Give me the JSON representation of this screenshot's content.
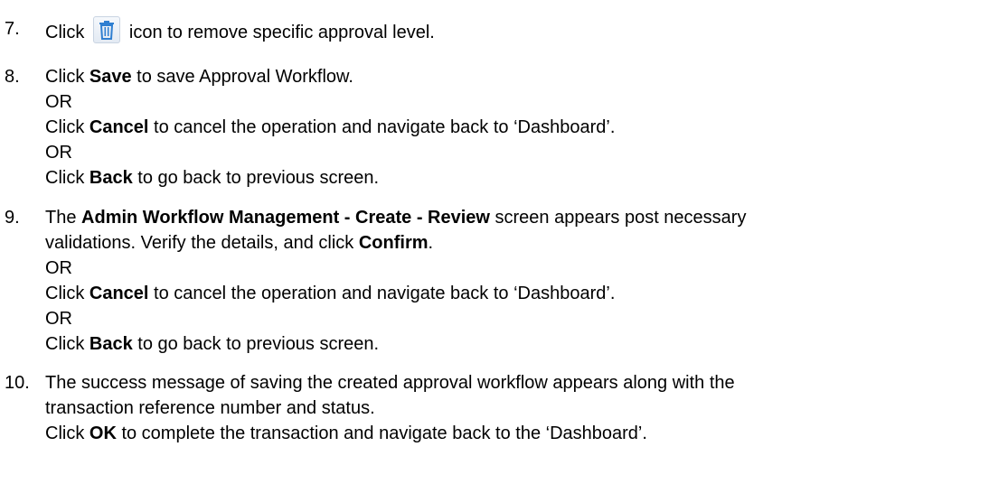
{
  "steps": [
    {
      "number": "7.",
      "parts": [
        "Click",
        "icon to remove specific approval level."
      ],
      "icon": "trash-icon"
    },
    {
      "number": "8.",
      "line1": [
        "Click ",
        "Save",
        " to save Approval Workflow."
      ],
      "or1": "OR",
      "line2": [
        "Click ",
        "Cancel",
        " to cancel the operation and navigate back to ‘Dashboard’."
      ],
      "or2": "OR",
      "line3": [
        "Click ",
        "Back",
        " to go back to previous screen."
      ]
    },
    {
      "number": "9.",
      "line1": [
        "The ",
        "Admin Workflow Management - Create - Review",
        " screen appears post necessary"
      ],
      "line1b": [
        "validations. Verify the details, and click ",
        "Confirm",
        "."
      ],
      "or1": "OR",
      "line2": [
        "Click ",
        "Cancel",
        " to cancel the operation and navigate back to ‘Dashboard’."
      ],
      "or2": "OR",
      "line3": [
        "Click ",
        "Back",
        " to go back to previous screen."
      ]
    },
    {
      "number": "10.",
      "line1": "The success message of saving the created approval workflow appears along with the",
      "line1b": "transaction reference number and status.",
      "line2": [
        "Click ",
        "OK",
        " to complete the transaction and navigate back to the ‘Dashboard’."
      ]
    }
  ],
  "colors": {
    "icon_blue": "#2f7fd1"
  }
}
